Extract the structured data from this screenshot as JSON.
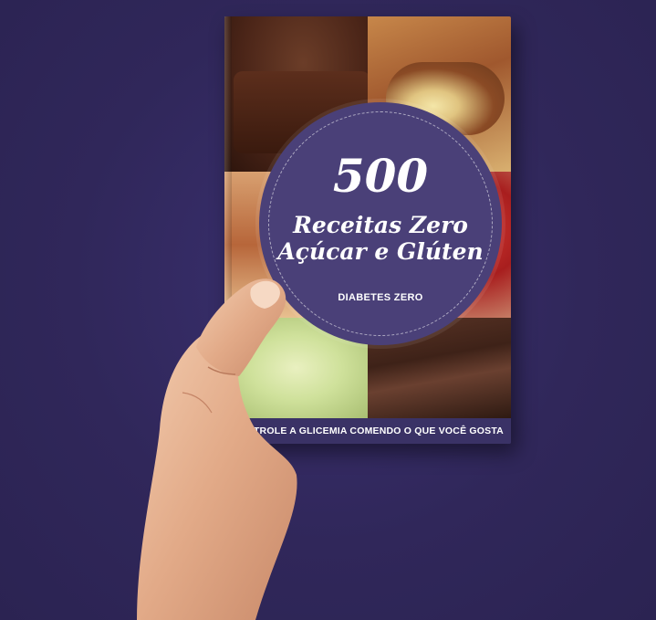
{
  "book": {
    "number": "500",
    "title_line1": "Receitas Zero",
    "title_line2": "Açúcar e Glúten",
    "brand": "DIABETES ZERO",
    "tagline": "CONTROLE A GLICEMIA COMENDO O QUE VOCÊ GOSTA"
  },
  "colors": {
    "background": "#30275a",
    "cover_purple": "#4a4078",
    "text": "#ffffff"
  }
}
